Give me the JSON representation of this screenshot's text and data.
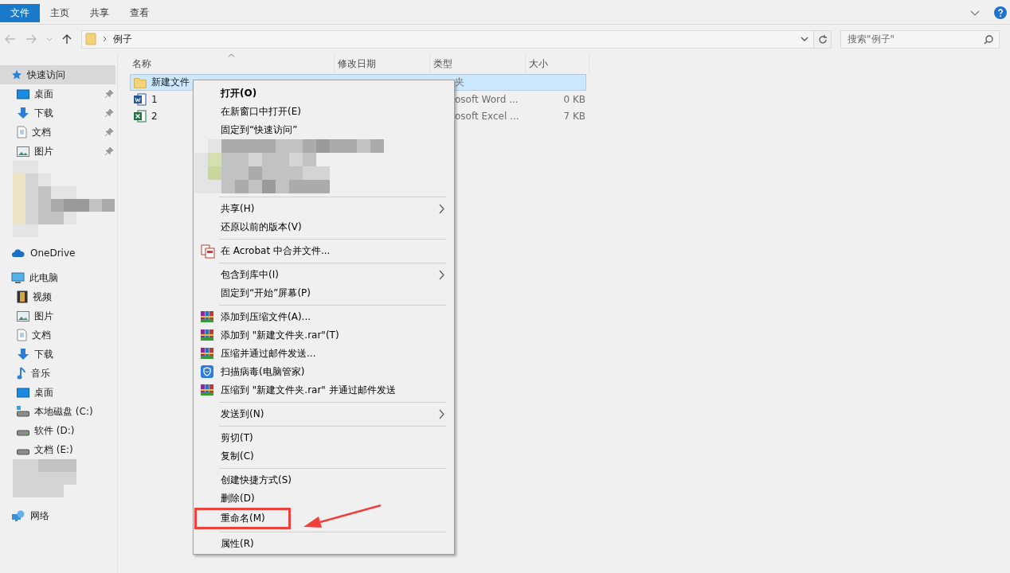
{
  "ribbon": {
    "tabs": [
      {
        "label": "文件",
        "selected": true
      },
      {
        "label": "主页",
        "selected": false
      },
      {
        "label": "共享",
        "selected": false
      },
      {
        "label": "查看",
        "selected": false
      }
    ]
  },
  "address": {
    "location": "例子"
  },
  "search": {
    "placeholder": "搜索\"例子\""
  },
  "sidebar": {
    "items": [
      {
        "kind": "quick",
        "label": "快速访问",
        "selected": true,
        "children": [
          {
            "kind": "desktop",
            "label": "桌面",
            "pinned": true,
            "selected": false
          },
          {
            "kind": "download",
            "label": "下载",
            "pinned": true,
            "selected": false
          },
          {
            "kind": "document",
            "label": "文档",
            "pinned": true,
            "selected": false
          },
          {
            "kind": "picture",
            "label": "图片",
            "pinned": true,
            "selected": false
          }
        ]
      },
      {
        "kind": "redacted"
      },
      {
        "kind": "cloud",
        "label": "OneDrive",
        "selected": false
      },
      {
        "kind": "pc",
        "label": "此电脑",
        "selected": false,
        "children": [
          {
            "kind": "video",
            "label": "视频",
            "pinned": false,
            "selected": false
          },
          {
            "kind": "picture",
            "label": "图片",
            "pinned": false,
            "selected": false
          },
          {
            "kind": "document",
            "label": "文档",
            "pinned": false,
            "selected": false
          },
          {
            "kind": "download",
            "label": "下载",
            "pinned": false,
            "selected": false
          },
          {
            "kind": "music",
            "label": "音乐",
            "pinned": false,
            "selected": false
          },
          {
            "kind": "desktop",
            "label": "桌面",
            "pinned": false,
            "selected": false
          },
          {
            "kind": "system-drive",
            "label": "本地磁盘 (C:)",
            "pinned": false,
            "selected": false
          },
          {
            "kind": "drive",
            "label": "软件 (D:)",
            "pinned": false,
            "selected": false
          },
          {
            "kind": "drive",
            "label": "文档 (E:)",
            "pinned": false,
            "selected": false
          }
        ]
      },
      {
        "kind": "redacted"
      },
      {
        "kind": "network",
        "label": "网络",
        "selected": false
      }
    ]
  },
  "file_list": {
    "columns": [
      "名称",
      "修改日期",
      "类型",
      "大小"
    ],
    "rows": [
      {
        "kind": "folder",
        "name": "新建文件",
        "type": "夹",
        "selected": true
      },
      {
        "kind": "word",
        "name": "1",
        "type": "osoft Word ...",
        "size": "0 KB",
        "selected": false
      },
      {
        "kind": "excel",
        "name": "2",
        "type": "osoft Excel ...",
        "size": "7 KB",
        "selected": false
      }
    ]
  },
  "context_menu": {
    "items": [
      {
        "kind": "plain",
        "label": "打开(O)",
        "default": true,
        "submenu": false,
        "annotated": false
      },
      {
        "kind": "plain",
        "label": "在新窗口中打开(E)",
        "default": false,
        "submenu": false,
        "annotated": false
      },
      {
        "kind": "plain",
        "label": "固定到“快速访问”",
        "default": false,
        "submenu": false,
        "annotated": false
      },
      {
        "kind": "redacted"
      },
      {
        "kind": "separator"
      },
      {
        "kind": "plain",
        "label": "共享(H)",
        "default": false,
        "submenu": true,
        "annotated": false
      },
      {
        "kind": "plain",
        "label": "还原以前的版本(V)",
        "default": false,
        "submenu": false,
        "annotated": false
      },
      {
        "kind": "separator"
      },
      {
        "kind": "acrobat",
        "label": "在 Acrobat 中合并文件...",
        "default": false,
        "submenu": false,
        "annotated": false
      },
      {
        "kind": "separator"
      },
      {
        "kind": "plain",
        "label": "包含到库中(I)",
        "default": false,
        "submenu": true,
        "annotated": false
      },
      {
        "kind": "plain",
        "label": "固定到“开始”屏幕(P)",
        "default": false,
        "submenu": false,
        "annotated": false
      },
      {
        "kind": "separator"
      },
      {
        "kind": "archive",
        "label": "添加到压缩文件(A)...",
        "default": false,
        "submenu": false,
        "annotated": false
      },
      {
        "kind": "archive",
        "label": "添加到 \"新建文件夹.rar\"(T)",
        "default": false,
        "submenu": false,
        "annotated": false
      },
      {
        "kind": "archive",
        "label": "压缩并通过邮件发送...",
        "default": false,
        "submenu": false,
        "annotated": false
      },
      {
        "kind": "antivirus",
        "label": "扫描病毒(电脑管家)",
        "default": false,
        "submenu": false,
        "annotated": false
      },
      {
        "kind": "archive",
        "label": "压缩到 \"新建文件夹.rar\" 并通过邮件发送",
        "default": false,
        "submenu": false,
        "annotated": false
      },
      {
        "kind": "separator"
      },
      {
        "kind": "plain",
        "label": "发送到(N)",
        "default": false,
        "submenu": true,
        "annotated": false
      },
      {
        "kind": "separator"
      },
      {
        "kind": "plain",
        "label": "剪切(T)",
        "default": false,
        "submenu": false,
        "annotated": false
      },
      {
        "kind": "plain",
        "label": "复制(C)",
        "default": false,
        "submenu": false,
        "annotated": false
      },
      {
        "kind": "separator"
      },
      {
        "kind": "plain",
        "label": "创建快捷方式(S)",
        "default": false,
        "submenu": false,
        "annotated": false
      },
      {
        "kind": "plain",
        "label": "删除(D)",
        "default": false,
        "submenu": false,
        "annotated": false
      },
      {
        "kind": "plain",
        "label": "重命名(M)",
        "default": false,
        "submenu": false,
        "annotated": true
      },
      {
        "kind": "separator"
      },
      {
        "kind": "plain",
        "label": "属性(R)",
        "default": false,
        "submenu": false,
        "annotated": false
      }
    ]
  }
}
